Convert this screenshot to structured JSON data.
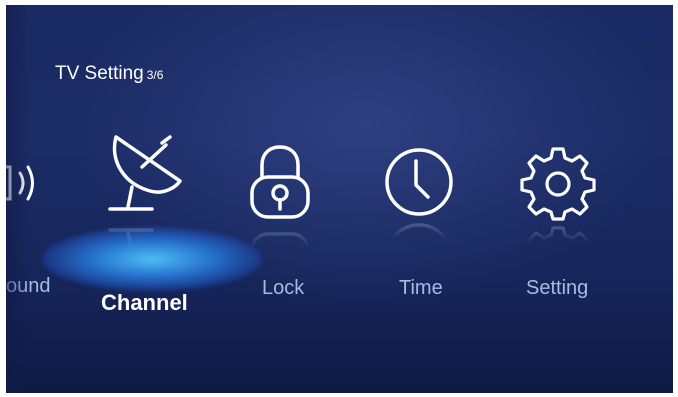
{
  "header": {
    "title": "TV Setting",
    "page_indicator": "3/6"
  },
  "menu": {
    "items": [
      {
        "label": "ound",
        "icon": "speaker-icon",
        "state": "partial"
      },
      {
        "label": "Channel",
        "icon": "satellite-dish-icon",
        "state": "selected"
      },
      {
        "label": "Lock",
        "icon": "padlock-icon",
        "state": "normal"
      },
      {
        "label": "Time",
        "icon": "clock-icon",
        "state": "normal"
      },
      {
        "label": "Setting",
        "icon": "gear-icon",
        "state": "normal"
      }
    ]
  },
  "colors": {
    "background": "#1b2c66",
    "icon": "#ffffff",
    "label_inactive": "#a9b9e6",
    "label_active": "#ffffff",
    "highlight_glow": "#3aa0f0"
  }
}
